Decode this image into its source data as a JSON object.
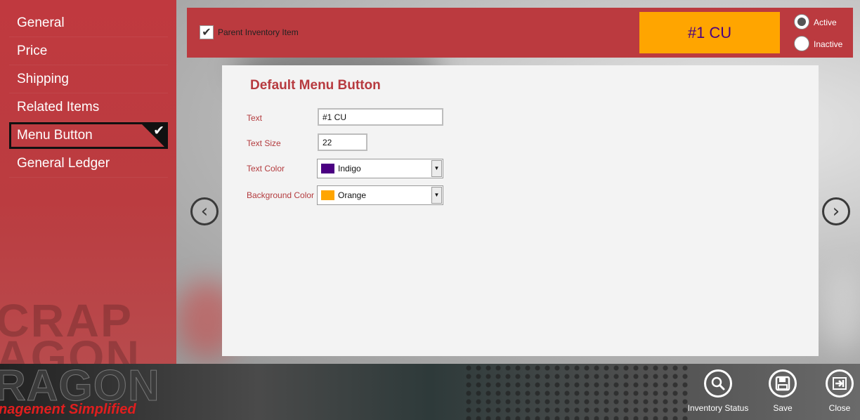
{
  "sidebar": {
    "items": [
      {
        "label": "General"
      },
      {
        "label": "Price"
      },
      {
        "label": "Shipping"
      },
      {
        "label": "Related Items"
      },
      {
        "label": "Menu Button"
      },
      {
        "label": "General Ledger"
      }
    ],
    "selected_index": 4
  },
  "topbar": {
    "parent_inventory_label": "Parent Inventory Item",
    "parent_inventory_checked": true,
    "preview_button_text": "#1 CU",
    "preview_button_bg": "#ffa500",
    "preview_button_fg": "#4b0082",
    "status_options": [
      {
        "label": "Active",
        "selected": true
      },
      {
        "label": "Inactive",
        "selected": false
      }
    ]
  },
  "form": {
    "title": "Default Menu Button",
    "text_label": "Text",
    "text_value": "#1 CU",
    "text_size_label": "Text Size",
    "text_size_value": "22",
    "text_color_label": "Text Color",
    "text_color_value": "Indigo",
    "text_color_swatch": "#4b0082",
    "bg_color_label": "Background Color",
    "bg_color_value": "Orange",
    "bg_color_swatch": "#ffa500"
  },
  "toolbar": {
    "inventory_status_label": "Inventory Status",
    "save_label": "Save",
    "close_label": "Close"
  },
  "colors": {
    "accent_red": "#bb3a3f",
    "label_red": "#b33b3e"
  }
}
